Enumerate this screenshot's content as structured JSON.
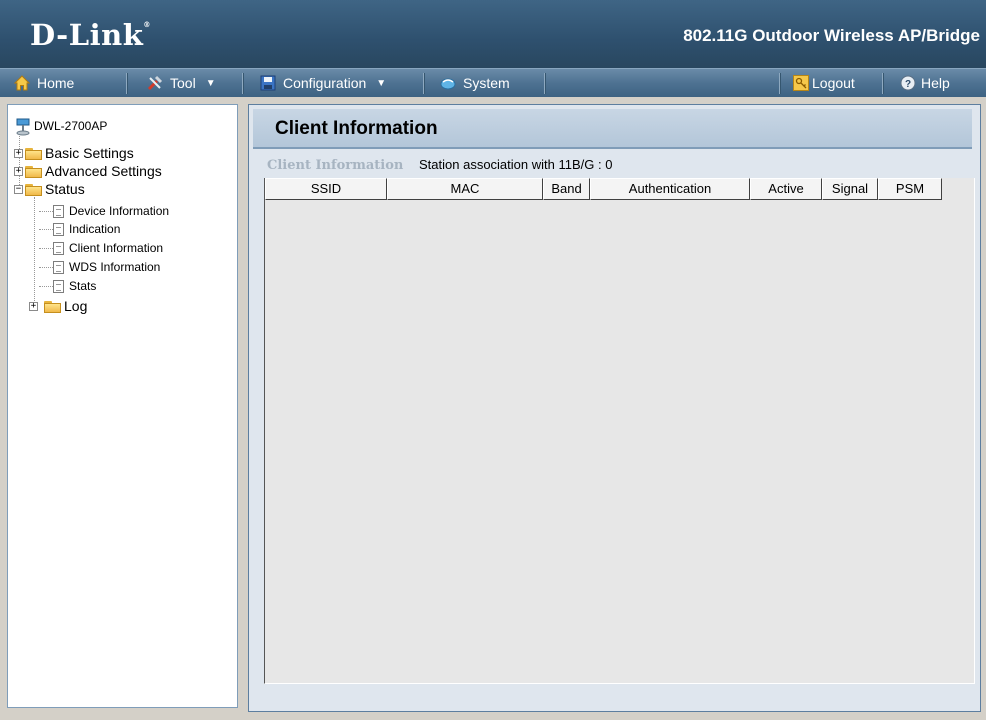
{
  "header": {
    "brand": "D-Link",
    "product": "802.11G Outdoor Wireless AP/Bridge"
  },
  "menu": {
    "home": "Home",
    "tool": "Tool",
    "configuration": "Configuration",
    "system": "System",
    "logout": "Logout",
    "help": "Help"
  },
  "sidebar": {
    "root": "DWL-2700AP",
    "basic": "Basic Settings",
    "advanced": "Advanced Settings",
    "status": "Status",
    "items": [
      "Device Information",
      "Indication",
      "Client Information",
      "WDS Information",
      "Stats"
    ],
    "log": "Log"
  },
  "main": {
    "title": "Client Information",
    "info_key": "Client Information",
    "info_value": "Station association with 11B/G : 0",
    "columns": [
      "SSID",
      "MAC",
      "Band",
      "Authentication",
      "Active",
      "Signal",
      "PSM"
    ],
    "rows": []
  },
  "colors": {
    "header_bg": "#2e506e",
    "menubar_bg": "#4e7292",
    "panel_title_bg": "#b3c6d9"
  }
}
